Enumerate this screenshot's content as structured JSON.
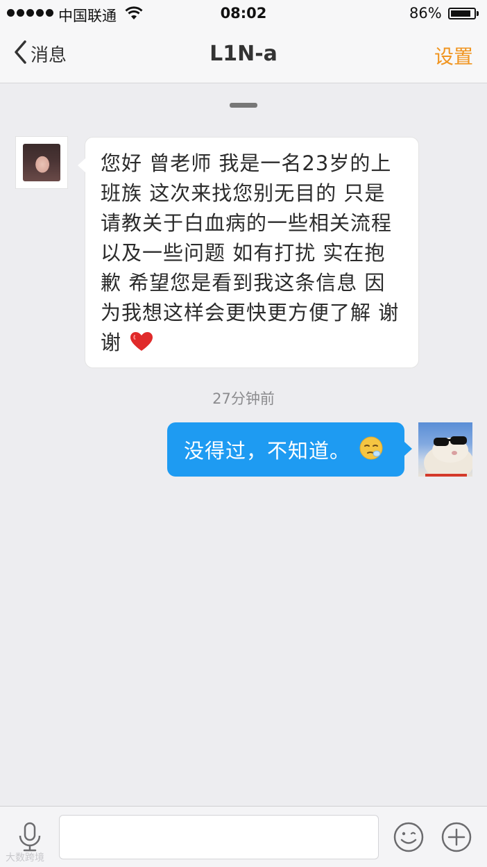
{
  "status_bar": {
    "carrier": "中国联通",
    "time": "08:02",
    "battery": "86%",
    "battery_level": 0.86,
    "icons": [
      "signal-dots",
      "wifi-icon",
      "battery-icon"
    ]
  },
  "nav": {
    "back_label": "消息",
    "title": "L1N-a",
    "settings_label": "设置",
    "accent_color": "#f0941f"
  },
  "messages": [
    {
      "sender": "other",
      "text": "您好 曾老师 我是一名23岁的上班族 这次来找您别无目的 只是请教关于白血病的一些相关流程 以及一些问题 如有打扰 实在抱歉 希望您是看到我这条信息 因为我想这样会更快更方便了解 谢谢",
      "emoji": "heart-icon"
    },
    {
      "sender": "me",
      "timestamp": "27分钟前",
      "text": "没得过，不知道。",
      "emoji": "sleepy-face-icon",
      "bubble_color": "#1e9bf2"
    }
  ],
  "input": {
    "placeholder": "",
    "value": ""
  },
  "watermark": "大数跨境"
}
